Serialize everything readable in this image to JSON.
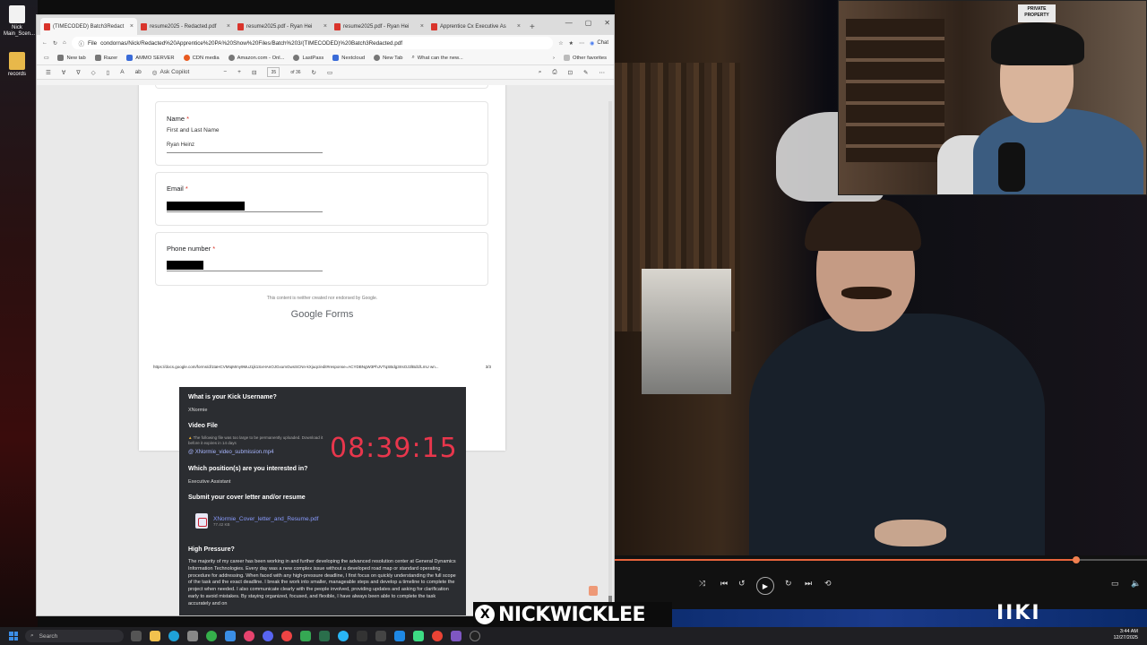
{
  "desktop": {
    "icons": [
      {
        "label": "Nick Main_Scen..."
      },
      {
        "label": "records"
      }
    ]
  },
  "browser": {
    "tabs": [
      {
        "label": "(TIMECODED) Batch3Redact",
        "active": true
      },
      {
        "label": "resume2025 - Redacted.pdf",
        "active": false
      },
      {
        "label": "resume2025.pdf - Ryan Hei",
        "active": false
      },
      {
        "label": "resume2025.pdf - Ryan Hei",
        "active": false
      },
      {
        "label": "Apprentice Cx Executive As",
        "active": false
      }
    ],
    "url_prefix": "File",
    "url": "condornas/Nick/Redacted%20Apprentice%20PA%20Show%20Files/Batch%203/(TIMECODED)%20Batch3Redacted.pdf",
    "chat_label": "Chat",
    "bookmarks": [
      "New tab",
      "Razer",
      "AMMO SERVER",
      "CDN media",
      "Amazon.com - Onl...",
      "LastPass",
      "Nextcloud",
      "New Tab",
      "What can the new..."
    ],
    "other_favorites": "Other favorites",
    "pdf_toolbar": {
      "copilot": "Ask Copilot",
      "page": "35",
      "of": "of 36"
    }
  },
  "form": {
    "name_label": "Name",
    "name_sub": "First and Last Name",
    "name_value": "Ryan Heinz",
    "email_label": "Email",
    "phone_label": "Phone number",
    "required_mark": "*",
    "disclaimer": "This content is neither created nor endorsed by Google.",
    "brand": "Google",
    "brand_suffix": "Forms",
    "footer_url": "https://docs.google.com/forms/d/1taHCVMIqMmy9MuJ1jk1SxHAnOJGxumGwsSCNn-kXjuqc/edit#response=ACYDBNgW3PhJVTqSBdg3rIsOJ2lBd1fLmU wn...",
    "page_num": "3/3"
  },
  "discord": {
    "q1": "What is your Kick Username?",
    "a1": "XNormie",
    "q2": "Video File",
    "warn": "The following file was too large to be permanently uploaded. Download it before it expires in 14 days",
    "video_link": "@ XNormie_video_submission.mp4",
    "q3": "Which position(s) are you interested in?",
    "a3": "Executive Assistant",
    "q4": "Submit your cover letter and/or resume",
    "file_name": "XNormie_Cover_letter_and_Resume.pdf",
    "file_size": "77.42 KB",
    "q5": "High Pressure?",
    "para": "The majority of my career has been working in and further developing the advanced resolution center at General Dynamics Information Technologies. Every day was a new complex issue without a developed road map or standard operating procedure for addressing. When faced with any high-pressure deadline, I first focus on quickly understanding the full scope of the task and the exact deadline. I break the work into smaller, manageable steps and develop a timeline to complete the project when needed. I also communicate clearly with the people involved, providing updates and asking for clarification early to avoid mistakes. By staying organized, focused, and flexible, I have always been able to complete the task accurately and on"
  },
  "timer": "08:39:15",
  "cam_sign": "PRIVATE PROPERTY",
  "player": {
    "progress": 0.867
  },
  "banner": "NICKWICKLEE",
  "banner_x": "X",
  "banner_right": "IIKI",
  "taskbar": {
    "search": "Search",
    "time": "3:44 AM",
    "date": "12/27/2025"
  },
  "colors": {
    "required": "#d93025",
    "timer": "#e8364c",
    "progress": "#e8643c",
    "discord_bg": "#2b2d31"
  }
}
